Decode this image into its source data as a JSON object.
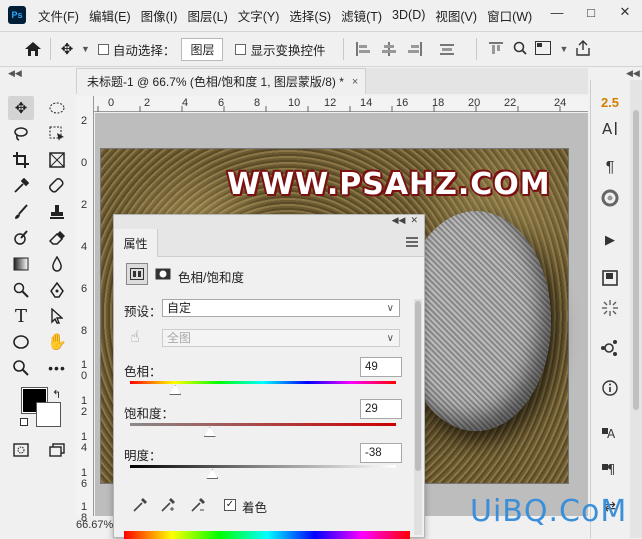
{
  "app": {
    "logo": "Ps"
  },
  "menu": [
    "文件(F)",
    "编辑(E)",
    "图像(I)",
    "图层(L)",
    "文字(Y)",
    "选择(S)",
    "滤镜(T)",
    "3D(D)",
    "视图(V)",
    "窗口(W)"
  ],
  "window_controls": {
    "minimize": "—",
    "restore": "□",
    "close": "✕"
  },
  "options": {
    "auto_select_label": "自动选择：",
    "auto_select_value": "图层",
    "show_transform_label": "显示变换控件"
  },
  "document": {
    "tab_title": "未标题-1 @ 66.7% (色相/饱和度 1, 图层蒙版/8) *",
    "close": "×",
    "zoom_status": "66.67%"
  },
  "ruler": {
    "top": [
      "2",
      "0",
      "2",
      "4",
      "6",
      "8",
      "10",
      "12",
      "14",
      "16",
      "18",
      "20",
      "22",
      "24"
    ],
    "left": [
      "2",
      "0",
      "2",
      "4",
      "6",
      "8",
      "1 0",
      "1 2",
      "1 4",
      "1 6",
      "1 8"
    ]
  },
  "canvas": {
    "watermark": "WWW.PSAHZ.COM"
  },
  "right_panel": {
    "font_size_label": "2.5"
  },
  "properties": {
    "tab": "属性",
    "adjustment_title": "色相/饱和度",
    "preset_label": "预设：",
    "preset_value": "自定",
    "channel_value": "全图",
    "hue_label": "色相：",
    "hue_value": "49",
    "hue_fraction": 0.17,
    "saturation_label": "饱和度：",
    "saturation_value": "29",
    "saturation_fraction": 0.3,
    "lightness_label": "明度：",
    "lightness_value": "-38",
    "lightness_fraction": 0.31,
    "colorize_label": "着色",
    "colorize_checked": true
  },
  "site_watermark": "UiBQ.CoM",
  "colors": {
    "foreground": "#000000",
    "background": "#ffffff",
    "watermark_outline": "#7a1010"
  }
}
